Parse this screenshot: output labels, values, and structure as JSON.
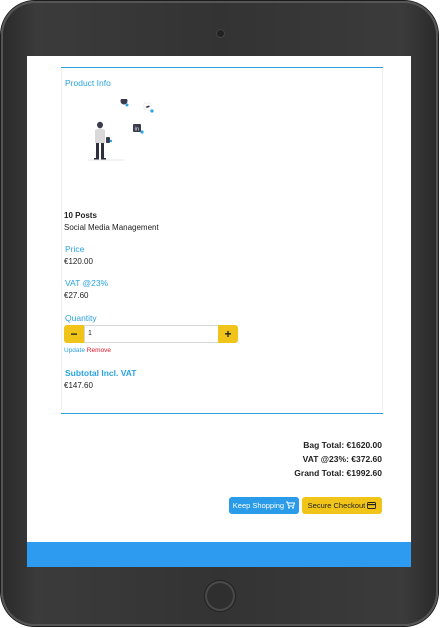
{
  "product": {
    "section_title": "Product Info",
    "name": "10 Posts",
    "description": "Social Media Management",
    "price_label": "Price",
    "price_value": "€120.00",
    "vat_label": "VAT @23%",
    "vat_value": "€27.60",
    "quantity_label": "Quantity",
    "quantity_value": "1",
    "qty_minus": "−",
    "qty_plus": "+",
    "update_link": "Update",
    "remove_link": "Remove",
    "subtotal_label": "Subtotal Incl. VAT",
    "subtotal_value": "€147.60"
  },
  "totals": {
    "bag_total": "Bag Total: €1620.00",
    "vat_total": "VAT @23%: €372.60",
    "grand_total": "Grand Total: €1992.60"
  },
  "actions": {
    "keep_shopping": "Keep Shopping",
    "secure_checkout": "Secure Checkout"
  },
  "icons": {
    "cart": "cart-icon",
    "card": "credit-card-icon",
    "illustration": "social-media-person-illustration"
  },
  "colors": {
    "accent_blue": "#2aa3e0",
    "button_yellow": "#f0c419",
    "remove_red": "#e0142b",
    "footer_blue": "#2d9bef"
  }
}
